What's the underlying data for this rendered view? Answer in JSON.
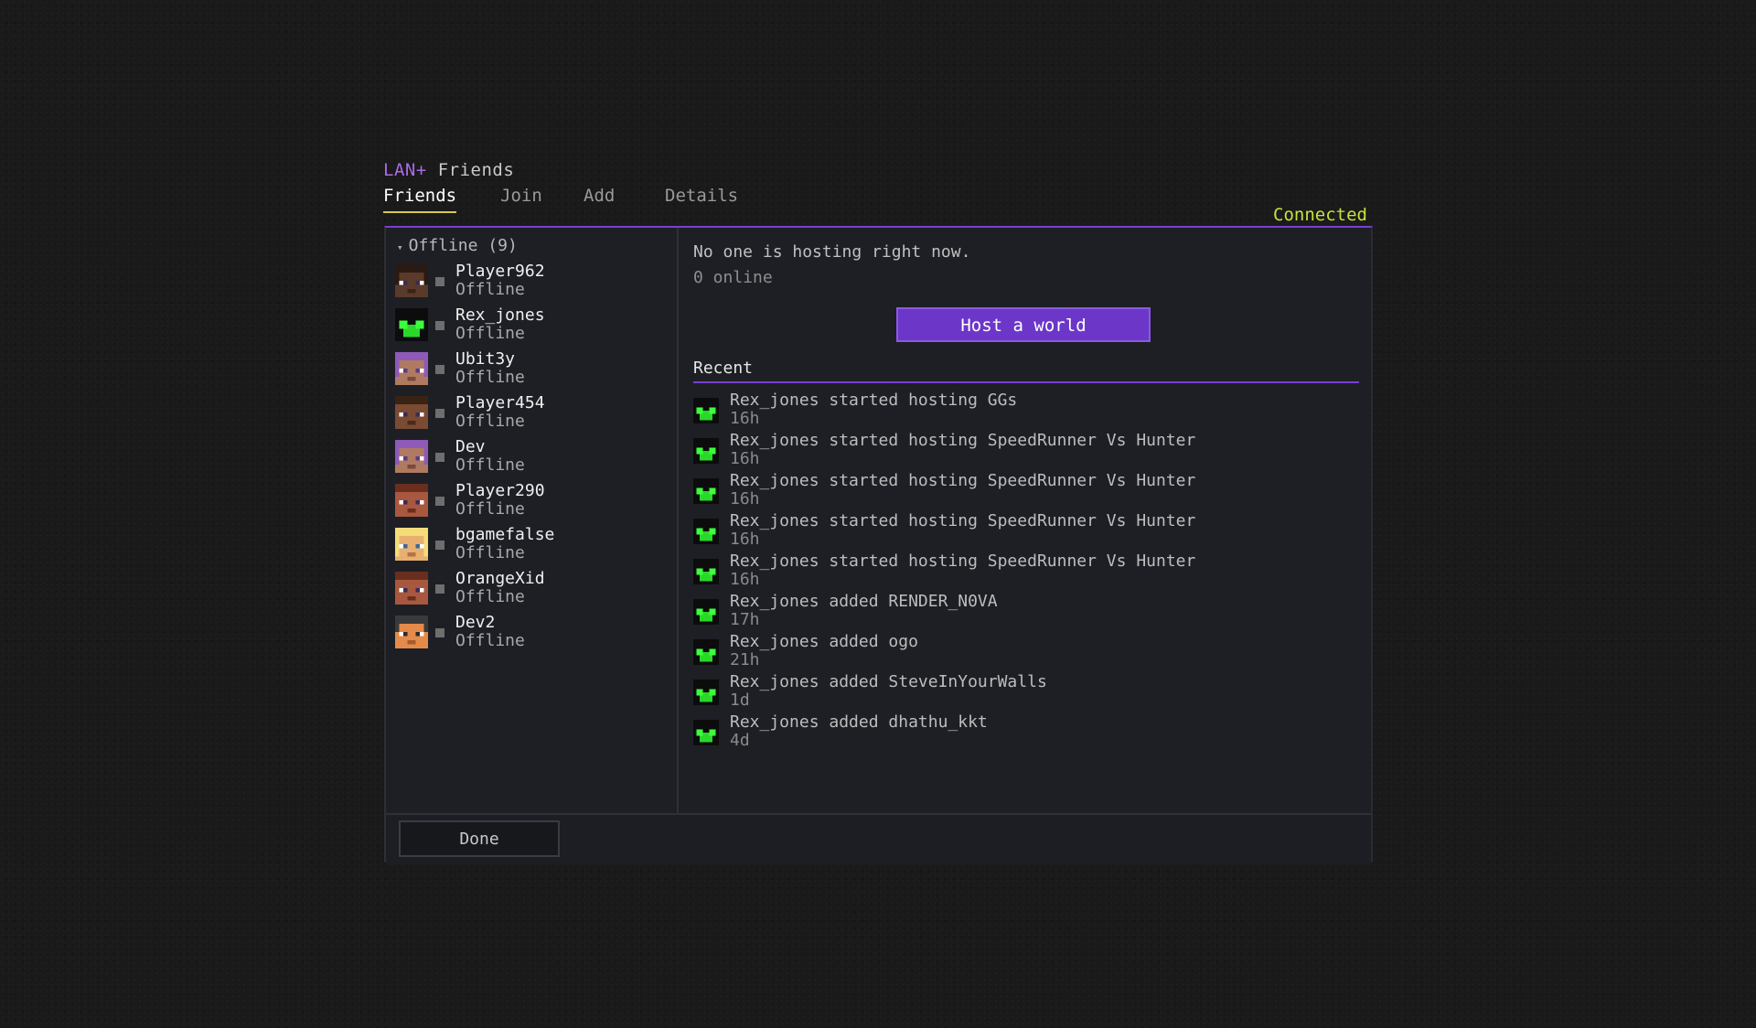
{
  "window": {
    "brand": "LAN",
    "brand_plus": "+",
    "title": "Friends"
  },
  "tabs": [
    {
      "label": "Friends",
      "active": true
    },
    {
      "label": "Join",
      "active": false
    },
    {
      "label": "Add",
      "active": false
    },
    {
      "label": "Details",
      "active": false
    }
  ],
  "status": {
    "label": "Connected",
    "color": "#c8e03c"
  },
  "friends_panel": {
    "group_label": "Offline (9)",
    "chevron_icon": "chevron-down-icon",
    "friends": [
      {
        "name": "Player962",
        "status": "Offline",
        "skin": "dark-brown-skin"
      },
      {
        "name": "Rex_jones",
        "status": "Offline",
        "skin": "green-creeper-skin"
      },
      {
        "name": "Ubit3y",
        "status": "Offline",
        "skin": "purple-hair-skin"
      },
      {
        "name": "Player454",
        "status": "Offline",
        "skin": "brown-skin"
      },
      {
        "name": "Dev",
        "status": "Offline",
        "skin": "purple-hair-skin"
      },
      {
        "name": "Player290",
        "status": "Offline",
        "skin": "red-brown-skin"
      },
      {
        "name": "bgamefalse",
        "status": "Offline",
        "skin": "blonde-skin"
      },
      {
        "name": "OrangeXid",
        "status": "Offline",
        "skin": "red-brown-skin"
      },
      {
        "name": "Dev2",
        "status": "Offline",
        "skin": "orange-skin"
      }
    ]
  },
  "host_panel": {
    "no_host_text": "No one is hosting right now.",
    "online_text": "0 online",
    "host_button": "Host a world",
    "recent_title": "Recent",
    "activity": [
      {
        "text": "Rex_jones started hosting GGs",
        "time": "16h"
      },
      {
        "text": "Rex_jones started hosting SpeedRunner Vs Hunter",
        "time": "16h"
      },
      {
        "text": "Rex_jones started hosting SpeedRunner Vs Hunter",
        "time": "16h"
      },
      {
        "text": "Rex_jones started hosting SpeedRunner Vs Hunter",
        "time": "16h"
      },
      {
        "text": "Rex_jones started hosting SpeedRunner Vs Hunter",
        "time": "16h"
      },
      {
        "text": "Rex_jones added RENDER_N0VA",
        "time": "17h"
      },
      {
        "text": "Rex_jones added ogo",
        "time": "21h"
      },
      {
        "text": "Rex_jones added SteveInYourWalls",
        "time": "1d"
      },
      {
        "text": "Rex_jones added dhathu_kkt",
        "time": "4d"
      }
    ]
  },
  "footer": {
    "done_button": "Done"
  },
  "colors": {
    "accent": "#7a3fcf",
    "host_button": "#6c37c9",
    "tab_underline": "#d8c84a"
  }
}
